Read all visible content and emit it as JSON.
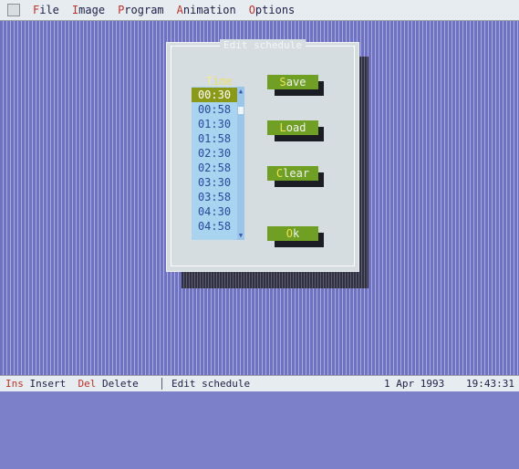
{
  "menu": {
    "items": [
      {
        "hot": "F",
        "rest": "ile"
      },
      {
        "hot": "I",
        "rest": "mage"
      },
      {
        "hot": "P",
        "rest": "rogram"
      },
      {
        "hot": "A",
        "rest": "nimation"
      },
      {
        "hot": "O",
        "rest": "ptions"
      }
    ]
  },
  "dialog": {
    "title": "Edit schedule",
    "list_header": {
      "hot": "T",
      "rest": "ime"
    },
    "times": [
      "00:30",
      "00:58",
      "01:30",
      "01:58",
      "02:30",
      "02:58",
      "03:30",
      "03:58",
      "04:30",
      "04:58"
    ],
    "selected_index": 0,
    "buttons": {
      "save": {
        "hot": "S",
        "rest": "ave"
      },
      "load": {
        "hot": "L",
        "rest": "oad"
      },
      "clear": {
        "hot": "C",
        "rest": "lear"
      },
      "ok": {
        "hot": "O",
        "rest": "k"
      }
    }
  },
  "statusbar": {
    "ins_key": "Ins",
    "ins_label": " Insert  ",
    "del_key": "Del",
    "del_label": " Delete",
    "message": "Edit schedule",
    "date": "1 Apr 1993",
    "time": "19:43:31"
  },
  "colors": {
    "desktop": "#7c80c8",
    "dialog": "#d6dde0",
    "list": "#a8d4f0",
    "button": "#6fa024",
    "hotkey": "#c0302a"
  }
}
